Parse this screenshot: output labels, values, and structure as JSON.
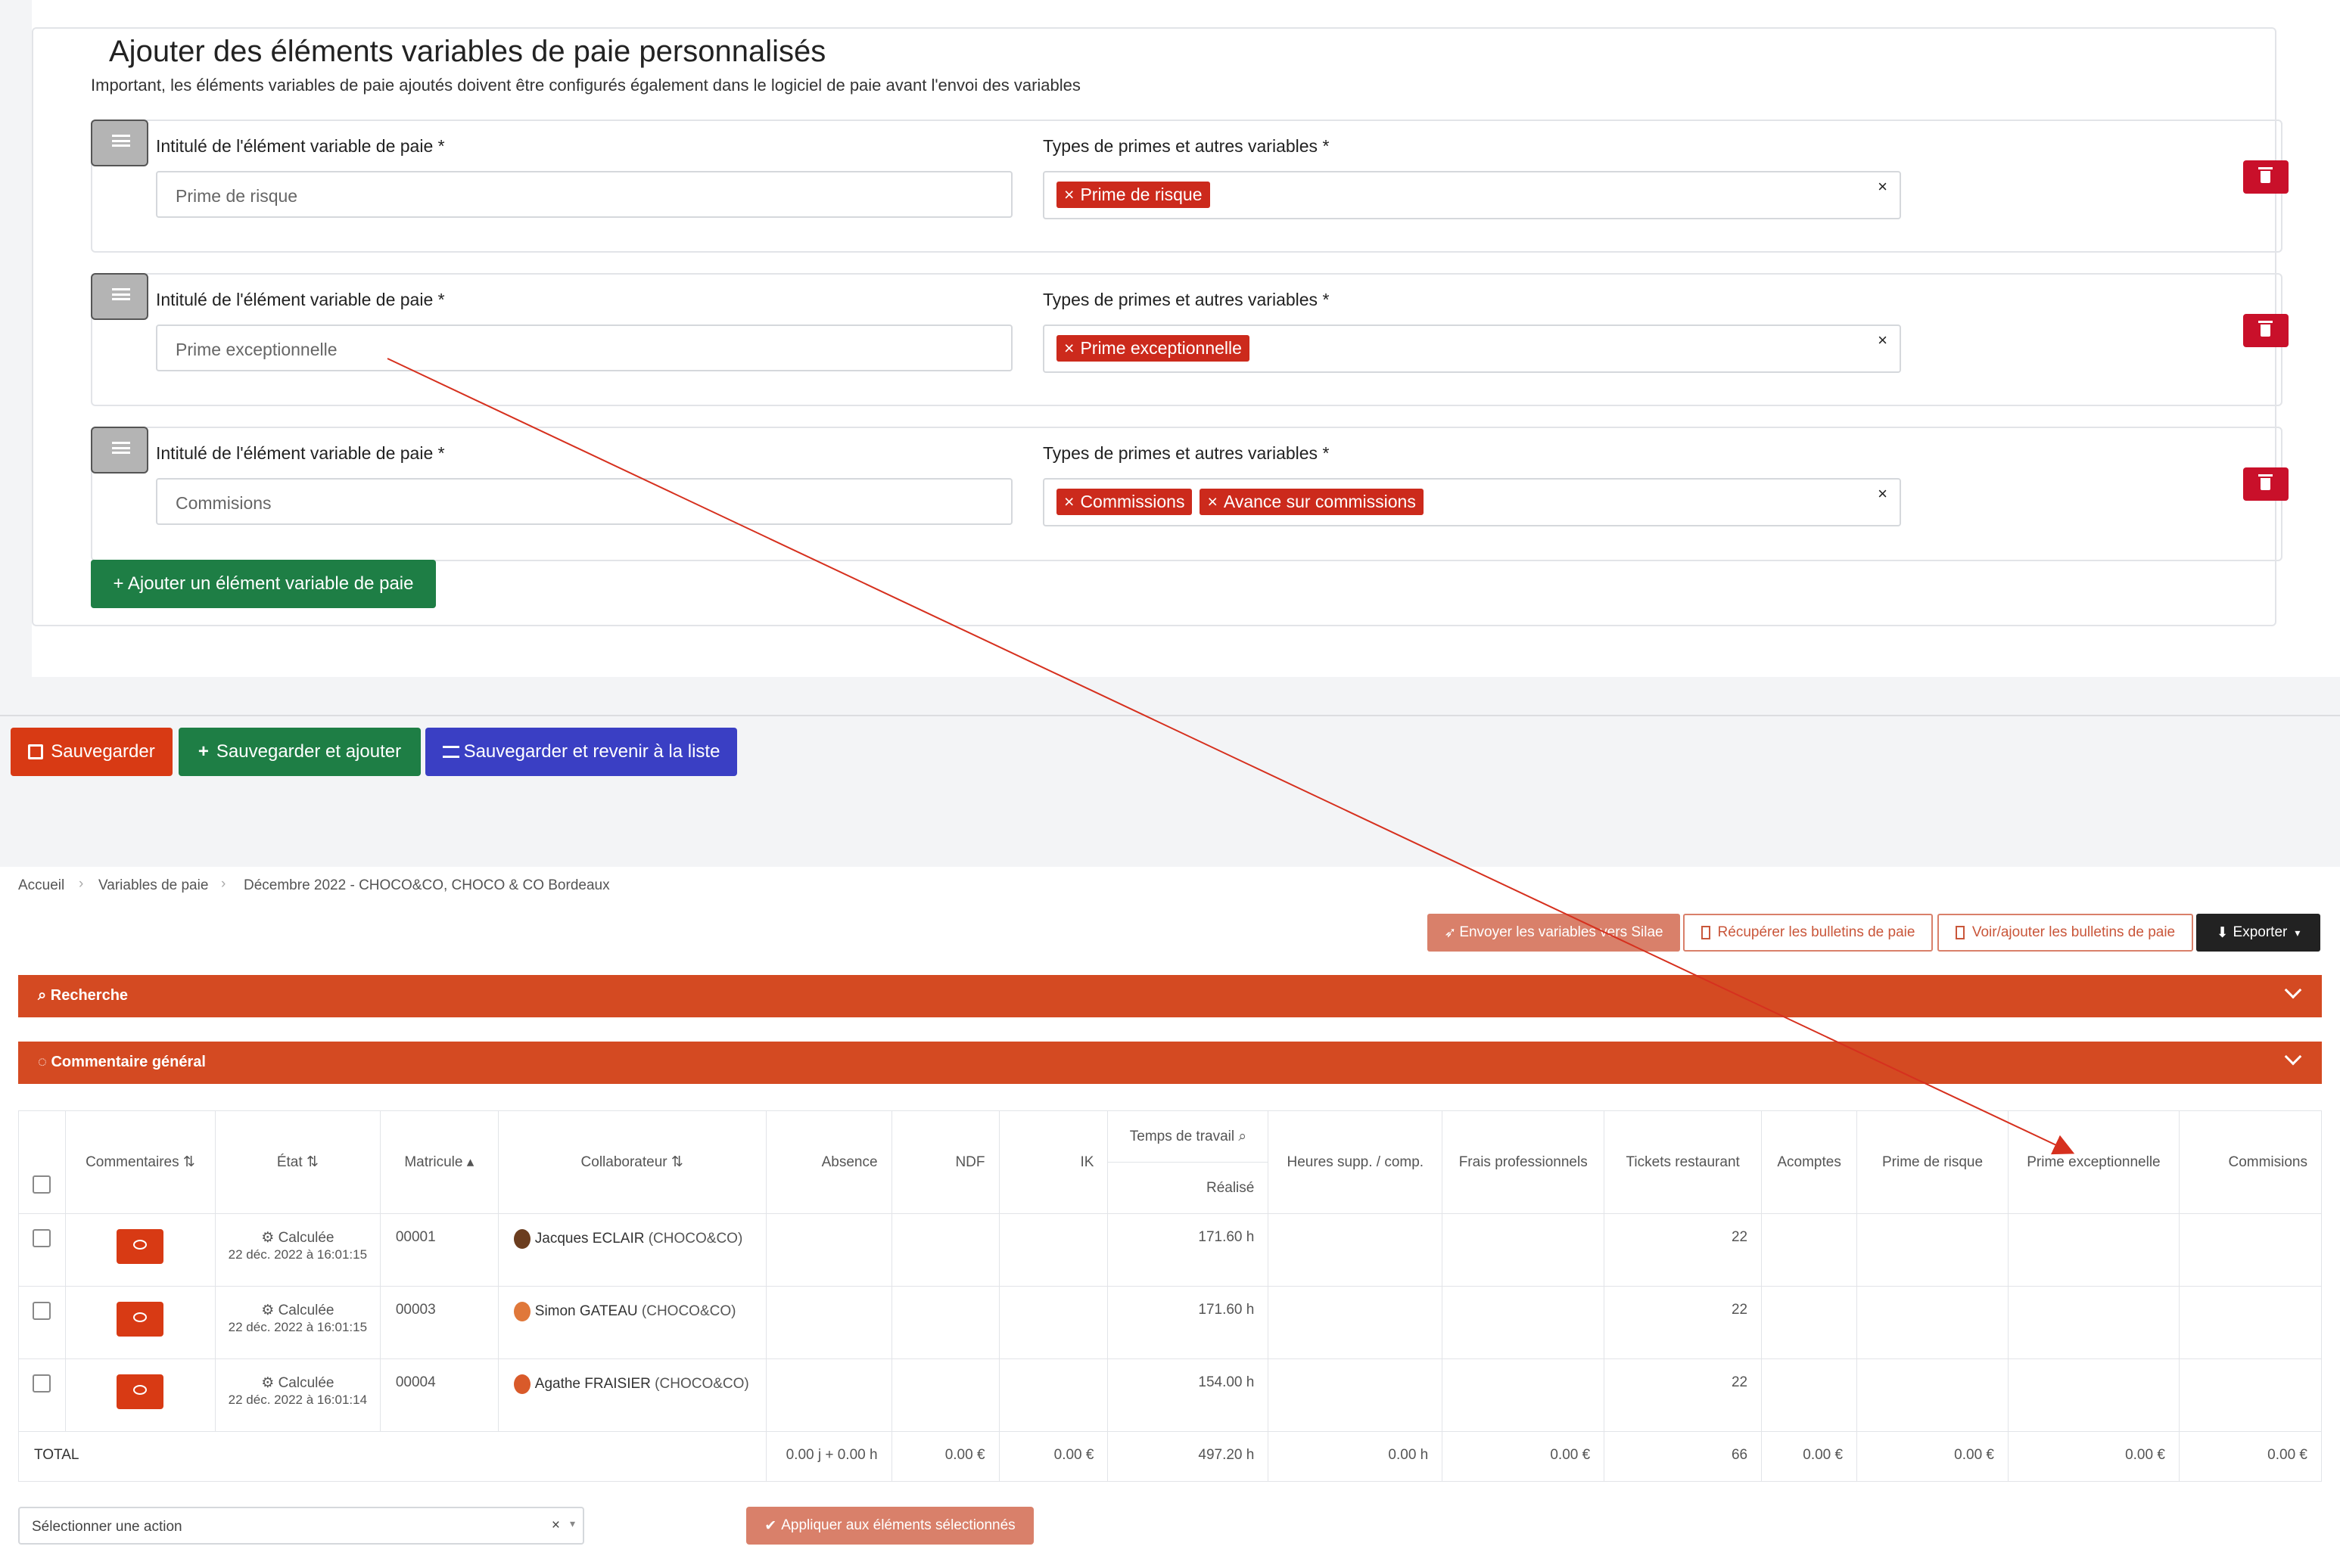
{
  "form": {
    "legend": "Ajouter des éléments variables de paie personnalisés",
    "note": "Important, les éléments variables de paie ajoutés doivent être configurés également dans le logiciel de paie avant l'envoi des variables",
    "field_label": "Intitulé de l'élément variable de paie *",
    "types_label": "Types de primes et autres variables *",
    "rows": [
      {
        "value": "Prime de risque",
        "tags": [
          "Prime de risque"
        ]
      },
      {
        "value": "Prime exceptionnelle",
        "tags": [
          "Prime exceptionnelle"
        ]
      },
      {
        "value": "Commisions",
        "tags": [
          "Commissions",
          "Avance sur commissions"
        ]
      }
    ],
    "tag_remove": "×",
    "select_clear": "×",
    "add_button": "+ Ajouter un élément variable de paie"
  },
  "actions": {
    "save": "Sauvegarder",
    "save_add": "Sauvegarder et ajouter",
    "save_return": "Sauvegarder et revenir à la liste"
  },
  "breadcrumb": [
    "Accueil",
    "Variables de paie",
    "Décembre 2022 - CHOCO&CO, CHOCO & CO Bordeaux"
  ],
  "toolbar": {
    "send": "Envoyer les variables vers Silae",
    "fetch": "Récupérer les bulletins de paie",
    "view": "Voir/ajouter les bulletins de paie",
    "export": "Exporter"
  },
  "panels": {
    "search": "Recherche",
    "comment": "Commentaire général"
  },
  "table": {
    "headers": {
      "comments": "Commentaires",
      "state": "État",
      "matricule": "Matricule",
      "collaborator": "Collaborateur",
      "absence": "Absence",
      "ndf": "NDF",
      "ik": "IK",
      "work_time": "Temps de travail",
      "realised": "Réalisé",
      "overtime": "Heures supp. / comp.",
      "fees": "Frais professionnels",
      "tickets": "Tickets restaurant",
      "deposits": "Acomptes",
      "risk": "Prime de risque",
      "exceptional": "Prime exceptionnelle",
      "commissions": "Commisions"
    },
    "rows": [
      {
        "state": "Calculée",
        "date": "22 déc. 2022 à 16:01:15",
        "matricule": "00001",
        "name": "Jacques ECLAIR",
        "company": "(CHOCO&CO)",
        "realised": "171.60 h",
        "tickets": "22",
        "avatar_color": "#6b3d1f"
      },
      {
        "state": "Calculée",
        "date": "22 déc. 2022 à 16:01:15",
        "matricule": "00003",
        "name": "Simon GATEAU",
        "company": "(CHOCO&CO)",
        "realised": "171.60 h",
        "tickets": "22",
        "avatar_color": "#e0783a"
      },
      {
        "state": "Calculée",
        "date": "22 déc. 2022 à 16:01:14",
        "matricule": "00004",
        "name": "Agathe FRAISIER",
        "company": "(CHOCO&CO)",
        "realised": "154.00 h",
        "tickets": "22",
        "avatar_color": "#d95a2a"
      }
    ],
    "total": {
      "label": "TOTAL",
      "absence": "0.00 j + 0.00 h",
      "ndf": "0.00 €",
      "ik": "0.00 €",
      "realised": "497.20 h",
      "overtime": "0.00 h",
      "fees": "0.00 €",
      "tickets": "66",
      "deposits": "0.00 €",
      "risk": "0.00 €",
      "exceptional": "0.00 €",
      "commissions": "0.00 €"
    }
  },
  "bulk": {
    "placeholder": "Sélectionner une action",
    "clear": "×",
    "apply": "Appliquer aux éléments sélectionnés"
  },
  "colors": {
    "primary_red": "#d44a22",
    "green": "#1e7e45",
    "blue": "#3a3fc4",
    "tag_red": "#cc2a1c",
    "dark": "#222222"
  }
}
